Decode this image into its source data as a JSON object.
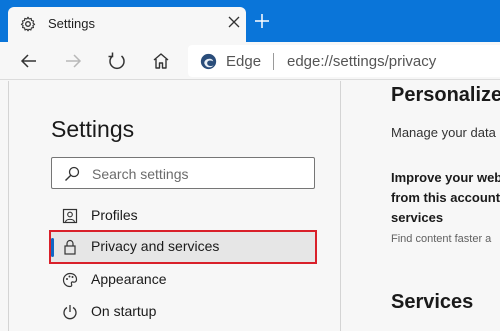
{
  "tab": {
    "title": "Settings",
    "icon": "gear-icon"
  },
  "toolbar": {
    "address_app": "Edge",
    "address_url": "edge://settings/privacy"
  },
  "sidebar": {
    "title": "Settings",
    "search_placeholder": "Search settings",
    "items": [
      {
        "label": "Profiles",
        "icon": "profile-icon",
        "active": false
      },
      {
        "label": "Privacy and services",
        "icon": "lock-icon",
        "active": true
      },
      {
        "label": "Appearance",
        "icon": "appearance-icon",
        "active": false
      },
      {
        "label": "On startup",
        "icon": "power-icon",
        "active": false
      }
    ]
  },
  "main": {
    "section_title": "Personalize y",
    "description": "Manage your data",
    "bold_lines": [
      "Improve your web",
      "from this account",
      "services"
    ],
    "small_text": "Find content faster a",
    "services_title": "Services"
  },
  "colors": {
    "tabstrip": "#0a75d9",
    "active_accent": "#1066c5",
    "highlight_border": "#d9202a"
  }
}
